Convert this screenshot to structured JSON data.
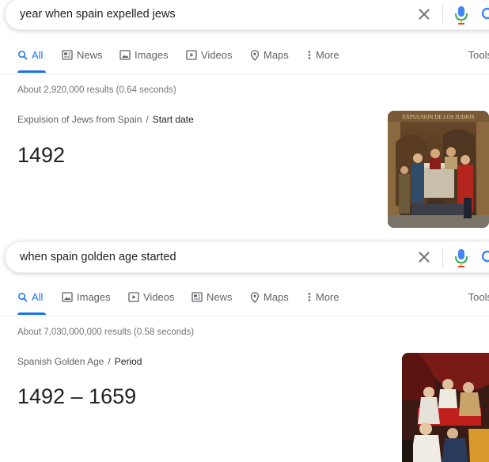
{
  "colors": {
    "accent": "#1a73e8",
    "muted": "#5f6368",
    "text": "#202124"
  },
  "panels": [
    {
      "query": "year when spain expelled jews",
      "tabs": [
        {
          "label": "All",
          "icon": "search-icon",
          "active": true
        },
        {
          "label": "News",
          "icon": "news-icon"
        },
        {
          "label": "Images",
          "icon": "image-icon"
        },
        {
          "label": "Videos",
          "icon": "video-icon"
        },
        {
          "label": "Maps",
          "icon": "map-pin-icon"
        },
        {
          "label": "More",
          "icon": "more-vert-icon"
        }
      ],
      "tools": "Tools",
      "stats": "About 2,920,000 results (0.64 seconds)",
      "entity": "Expulsion of Jews from Spain",
      "attribute": "Start date",
      "answer": "1492",
      "image_caption": "EXPULSION DE LOS JUDIOS"
    },
    {
      "query": "when spain golden age started",
      "tabs": [
        {
          "label": "All",
          "icon": "search-icon",
          "active": true
        },
        {
          "label": "Images",
          "icon": "image-icon"
        },
        {
          "label": "Videos",
          "icon": "video-icon"
        },
        {
          "label": "News",
          "icon": "news-icon"
        },
        {
          "label": "Maps",
          "icon": "map-pin-icon"
        },
        {
          "label": "More",
          "icon": "more-vert-icon"
        }
      ],
      "tools": "Tools",
      "stats": "About 7,030,000,000 results (0.58 seconds)",
      "entity": "Spanish Golden Age",
      "attribute": "Period",
      "answer": "1492 – 1659"
    }
  ],
  "separator": "/"
}
